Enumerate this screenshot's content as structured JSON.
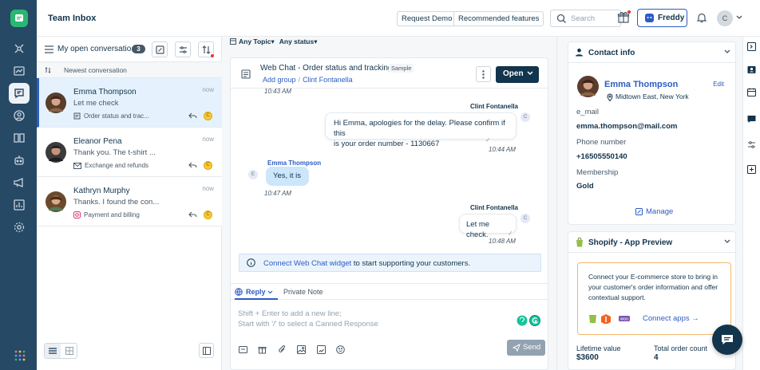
{
  "header": {
    "title": "Team Inbox",
    "request_demo": "Request Demo",
    "recommended": "Recommended features",
    "search_placeholder": "Search",
    "freddy": "Freddy",
    "avatar_initial": "C"
  },
  "list": {
    "view_title": "My open conversatio...",
    "view_count": "3",
    "sort_label": "Newest conversation",
    "conversations": [
      {
        "name": "Emma Thompson",
        "message": "Let me check",
        "time": "now",
        "tag": "Order status and trac...",
        "tag_icon": "document-icon"
      },
      {
        "name": "Eleanor Pena",
        "message": "Thank you. The t-shirt ...",
        "time": "now",
        "tag": "Exchange and refunds",
        "tag_icon": "mail-icon"
      },
      {
        "name": "Kathryn Murphy",
        "message": "Thanks. I found the con...",
        "time": "now",
        "tag": "Payment and billing",
        "tag_icon": "instagram-icon"
      }
    ]
  },
  "filters": {
    "topic": "Any Topic",
    "status": "Any status"
  },
  "chat": {
    "title": "Web Chat - Order status and tracking",
    "sample": "Sample",
    "add_group": "Add group",
    "separator": "/",
    "agent": "Clint Fontanella",
    "open_label": "Open",
    "messages": {
      "top_time": "10:43 AM",
      "m1_sender": "Clint Fontanella",
      "m1_text_line1": "Hi Emma, apologies for the delay. Please confirm if this",
      "m1_text_line2": "is your order number - 1130667",
      "m1_time": "10:44 AM",
      "m2_sender": "Emma Thompson",
      "m2_text": "Yes, it is",
      "m2_time": "10:47 AM",
      "m3_sender": "Clint Fontanella",
      "m3_text": "Let me check.",
      "m3_time": "10:48 AM",
      "avatar_c": "C",
      "avatar_e": "E"
    },
    "connect_link": "Connect Web Chat widget",
    "connect_rest": " to start supporting your customers."
  },
  "composer": {
    "reply_tab": "Reply",
    "private_tab": "Private Note",
    "placeholder_line1": "Shift + Enter to add a new line;",
    "placeholder_line2": "Start with '/' to select a Canned Response",
    "send": "Send"
  },
  "contact": {
    "heading": "Contact info",
    "name": "Emma Thompson",
    "edit": "Edit",
    "location": "Midtown East, New York",
    "email_label": "e_mail",
    "email": "emma.thompson@mail.com",
    "phone_label": "Phone number",
    "phone": "+16505550140",
    "membership_label": "Membership",
    "membership": "Gold",
    "manage": "Manage"
  },
  "shopify": {
    "heading": "Shopify - App Preview",
    "promo_text": "Connect your E-commerce store to bring in your customer's order information and offer contextual support.",
    "connect_apps": "Connect apps →",
    "lifetime_label": "Lifetime value",
    "lifetime_value": "$3600",
    "orders_label": "Total order count",
    "orders_value": "4"
  },
  "colors": {
    "rail": "#264966",
    "accent": "#2c5cc5",
    "primary_dark": "#12344d",
    "selected_row": "#e5f2fd",
    "incoming_bubble": "#cce6fc",
    "promo_border": "#f4b56c"
  }
}
